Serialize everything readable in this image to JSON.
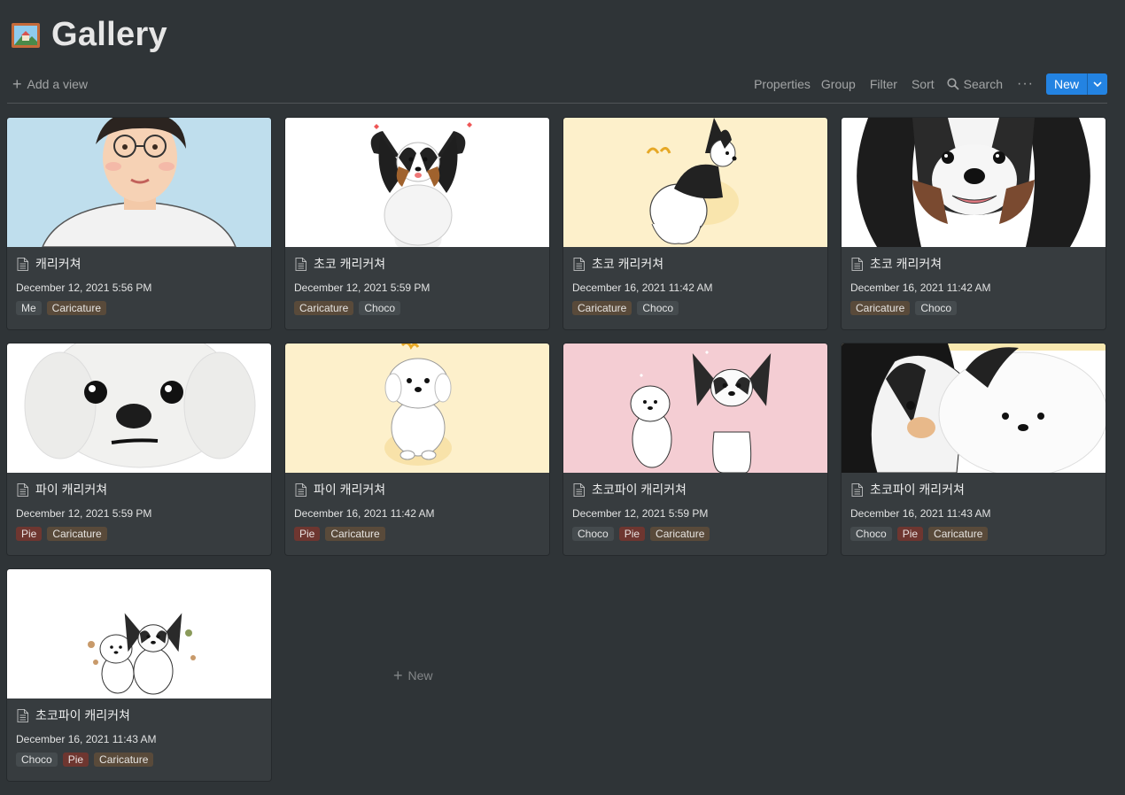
{
  "page": {
    "title": "Gallery",
    "icon": "framed-picture-icon"
  },
  "toolbar": {
    "add_view": "Add a view",
    "properties": "Properties",
    "group": "Group",
    "filter": "Filter",
    "sort": "Sort",
    "search": "Search",
    "more": "···",
    "new": "New"
  },
  "cards": [
    {
      "title": "캐리커쳐",
      "date": "December 12, 2021 5:56 PM",
      "tags": [
        "Me",
        "Caricature"
      ],
      "cover": "portrait-boy"
    },
    {
      "title": "초코 캐리커쳐",
      "date": "December 12, 2021 5:59 PM",
      "tags": [
        "Caricature",
        "Choco"
      ],
      "cover": "papillon-front"
    },
    {
      "title": "초코 캐리커쳐",
      "date": "December 16, 2021 11:42 AM",
      "tags": [
        "Caricature",
        "Choco"
      ],
      "cover": "papillon-back"
    },
    {
      "title": "초코 캐리커쳐",
      "date": "December 16, 2021 11:42 AM",
      "tags": [
        "Caricature",
        "Choco"
      ],
      "cover": "papillon-closeup"
    },
    {
      "title": "파이 캐리커쳐",
      "date": "December 12, 2021 5:59 PM",
      "tags": [
        "Pie",
        "Caricature"
      ],
      "cover": "white-dog-closeup"
    },
    {
      "title": "파이 캐리커쳐",
      "date": "December 16, 2021 11:42 AM",
      "tags": [
        "Pie",
        "Caricature"
      ],
      "cover": "white-dog-sitting"
    },
    {
      "title": "초코파이 캐리커쳐",
      "date": "December 12, 2021 5:59 PM",
      "tags": [
        "Choco",
        "Pie",
        "Caricature"
      ],
      "cover": "two-dogs-pink"
    },
    {
      "title": "초코파이 캐리커쳐",
      "date": "December 16, 2021 11:43 AM",
      "tags": [
        "Choco",
        "Pie",
        "Caricature"
      ],
      "cover": "two-dogs-closeup"
    },
    {
      "title": "초코파이 캐리커쳐",
      "date": "December 16, 2021 11:43 AM",
      "tags": [
        "Choco",
        "Pie",
        "Caricature"
      ],
      "cover": "two-dogs-small"
    }
  ],
  "new_card": "New",
  "tag_colors": {
    "Me": "#454b4e",
    "Caricature": "#594a3a",
    "Choco": "#454b4e",
    "Pie": "#6e3630"
  },
  "cover_colors": {
    "portrait-boy": "#bfdeed",
    "papillon-front": "#ffffff",
    "papillon-back": "#fdf0cb",
    "papillon-closeup": "#ffffff",
    "white-dog-closeup": "#ffffff",
    "white-dog-sitting": "#fdf0cb",
    "two-dogs-pink": "#f4cdd3",
    "two-dogs-closeup": "#ffffff",
    "two-dogs-small": "#ffffff"
  },
  "accent": "#2383e2"
}
